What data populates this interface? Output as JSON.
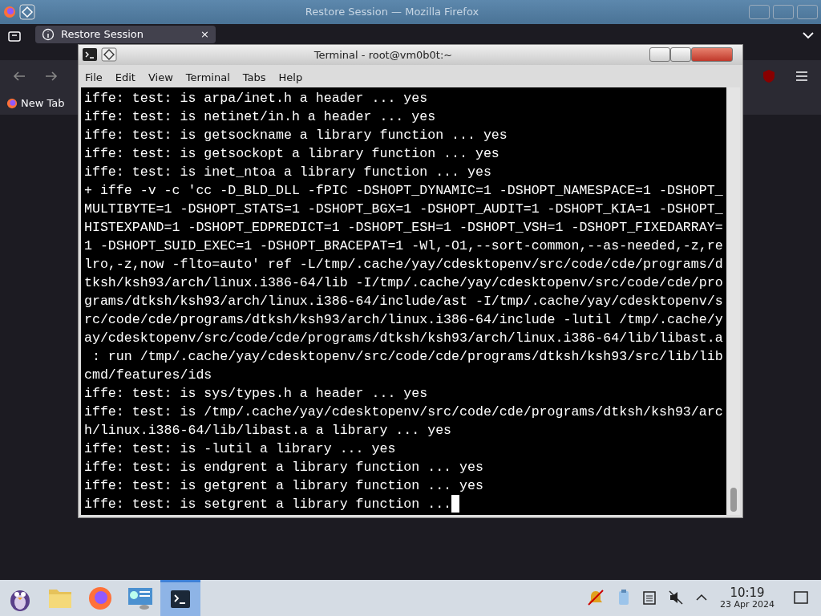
{
  "firefox": {
    "title": "Restore Session — Mozilla Firefox",
    "tab": {
      "label": "Restore Session",
      "close": "×",
      "selected": true
    },
    "bookmarks": [
      "New Tab"
    ]
  },
  "terminal": {
    "title": "Terminal - root@vm0b0t:~",
    "menu": [
      "File",
      "Edit",
      "View",
      "Terminal",
      "Tabs",
      "Help"
    ],
    "lines": [
      "iffe: test: is arpa/inet.h a header ... yes",
      "iffe: test: is netinet/in.h a header ... yes",
      "iffe: test: is getsockname a library function ... yes",
      "iffe: test: is getsockopt a library function ... yes",
      "iffe: test: is inet_ntoa a library function ... yes",
      "+ iffe -v -c 'cc -D_BLD_DLL -fPIC -DSHOPT_DYNAMIC=1 -DSHOPT_NAMESPACE=1 -DSHOPT_",
      "MULTIBYTE=1 -DSHOPT_STATS=1 -DSHOPT_BGX=1 -DSHOPT_AUDIT=1 -DSHOPT_KIA=1 -DSHOPT_",
      "HISTEXPAND=1 -DSHOPT_EDPREDICT=1 -DSHOPT_ESH=1 -DSHOPT_VSH=1 -DSHOPT_FIXEDARRAY=",
      "1 -DSHOPT_SUID_EXEC=1 -DSHOPT_BRACEPAT=1 -Wl,-O1,--sort-common,--as-needed,-z,re",
      "lro,-z,now -flto=auto' ref -L/tmp/.cache/yay/cdesktopenv/src/code/cde/programs/d",
      "tksh/ksh93/arch/linux.i386-64/lib -I/tmp/.cache/yay/cdesktopenv/src/code/cde/pro",
      "grams/dtksh/ksh93/arch/linux.i386-64/include/ast -I/tmp/.cache/yay/cdesktopenv/s",
      "rc/code/cde/programs/dtksh/ksh93/arch/linux.i386-64/include -lutil /tmp/.cache/y",
      "ay/cdesktopenv/src/code/cde/programs/dtksh/ksh93/arch/linux.i386-64/lib/libast.a",
      " : run /tmp/.cache/yay/cdesktopenv/src/code/cde/programs/dtksh/ksh93/src/lib/lib",
      "cmd/features/ids",
      "iffe: test: is sys/types.h a header ... yes",
      "iffe: test: is /tmp/.cache/yay/cdesktopenv/src/code/cde/programs/dtksh/ksh93/arc",
      "h/linux.i386-64/lib/libast.a a library ... yes",
      "iffe: test: is -lutil a library ... yes",
      "iffe: test: is endgrent a library function ... yes",
      "iffe: test: is getgrent a library function ... yes",
      "iffe: test: is setgrent a library function ..."
    ],
    "cursor": true
  },
  "taskbar": {
    "apps": [
      {
        "kind": "launcher",
        "selected": false
      },
      {
        "kind": "files",
        "selected": false
      },
      {
        "kind": "browser",
        "selected": false
      },
      {
        "kind": "settings",
        "selected": false
      },
      {
        "kind": "terminal",
        "selected": true
      }
    ],
    "time": "10:19",
    "date": "23 Apr 2024"
  }
}
